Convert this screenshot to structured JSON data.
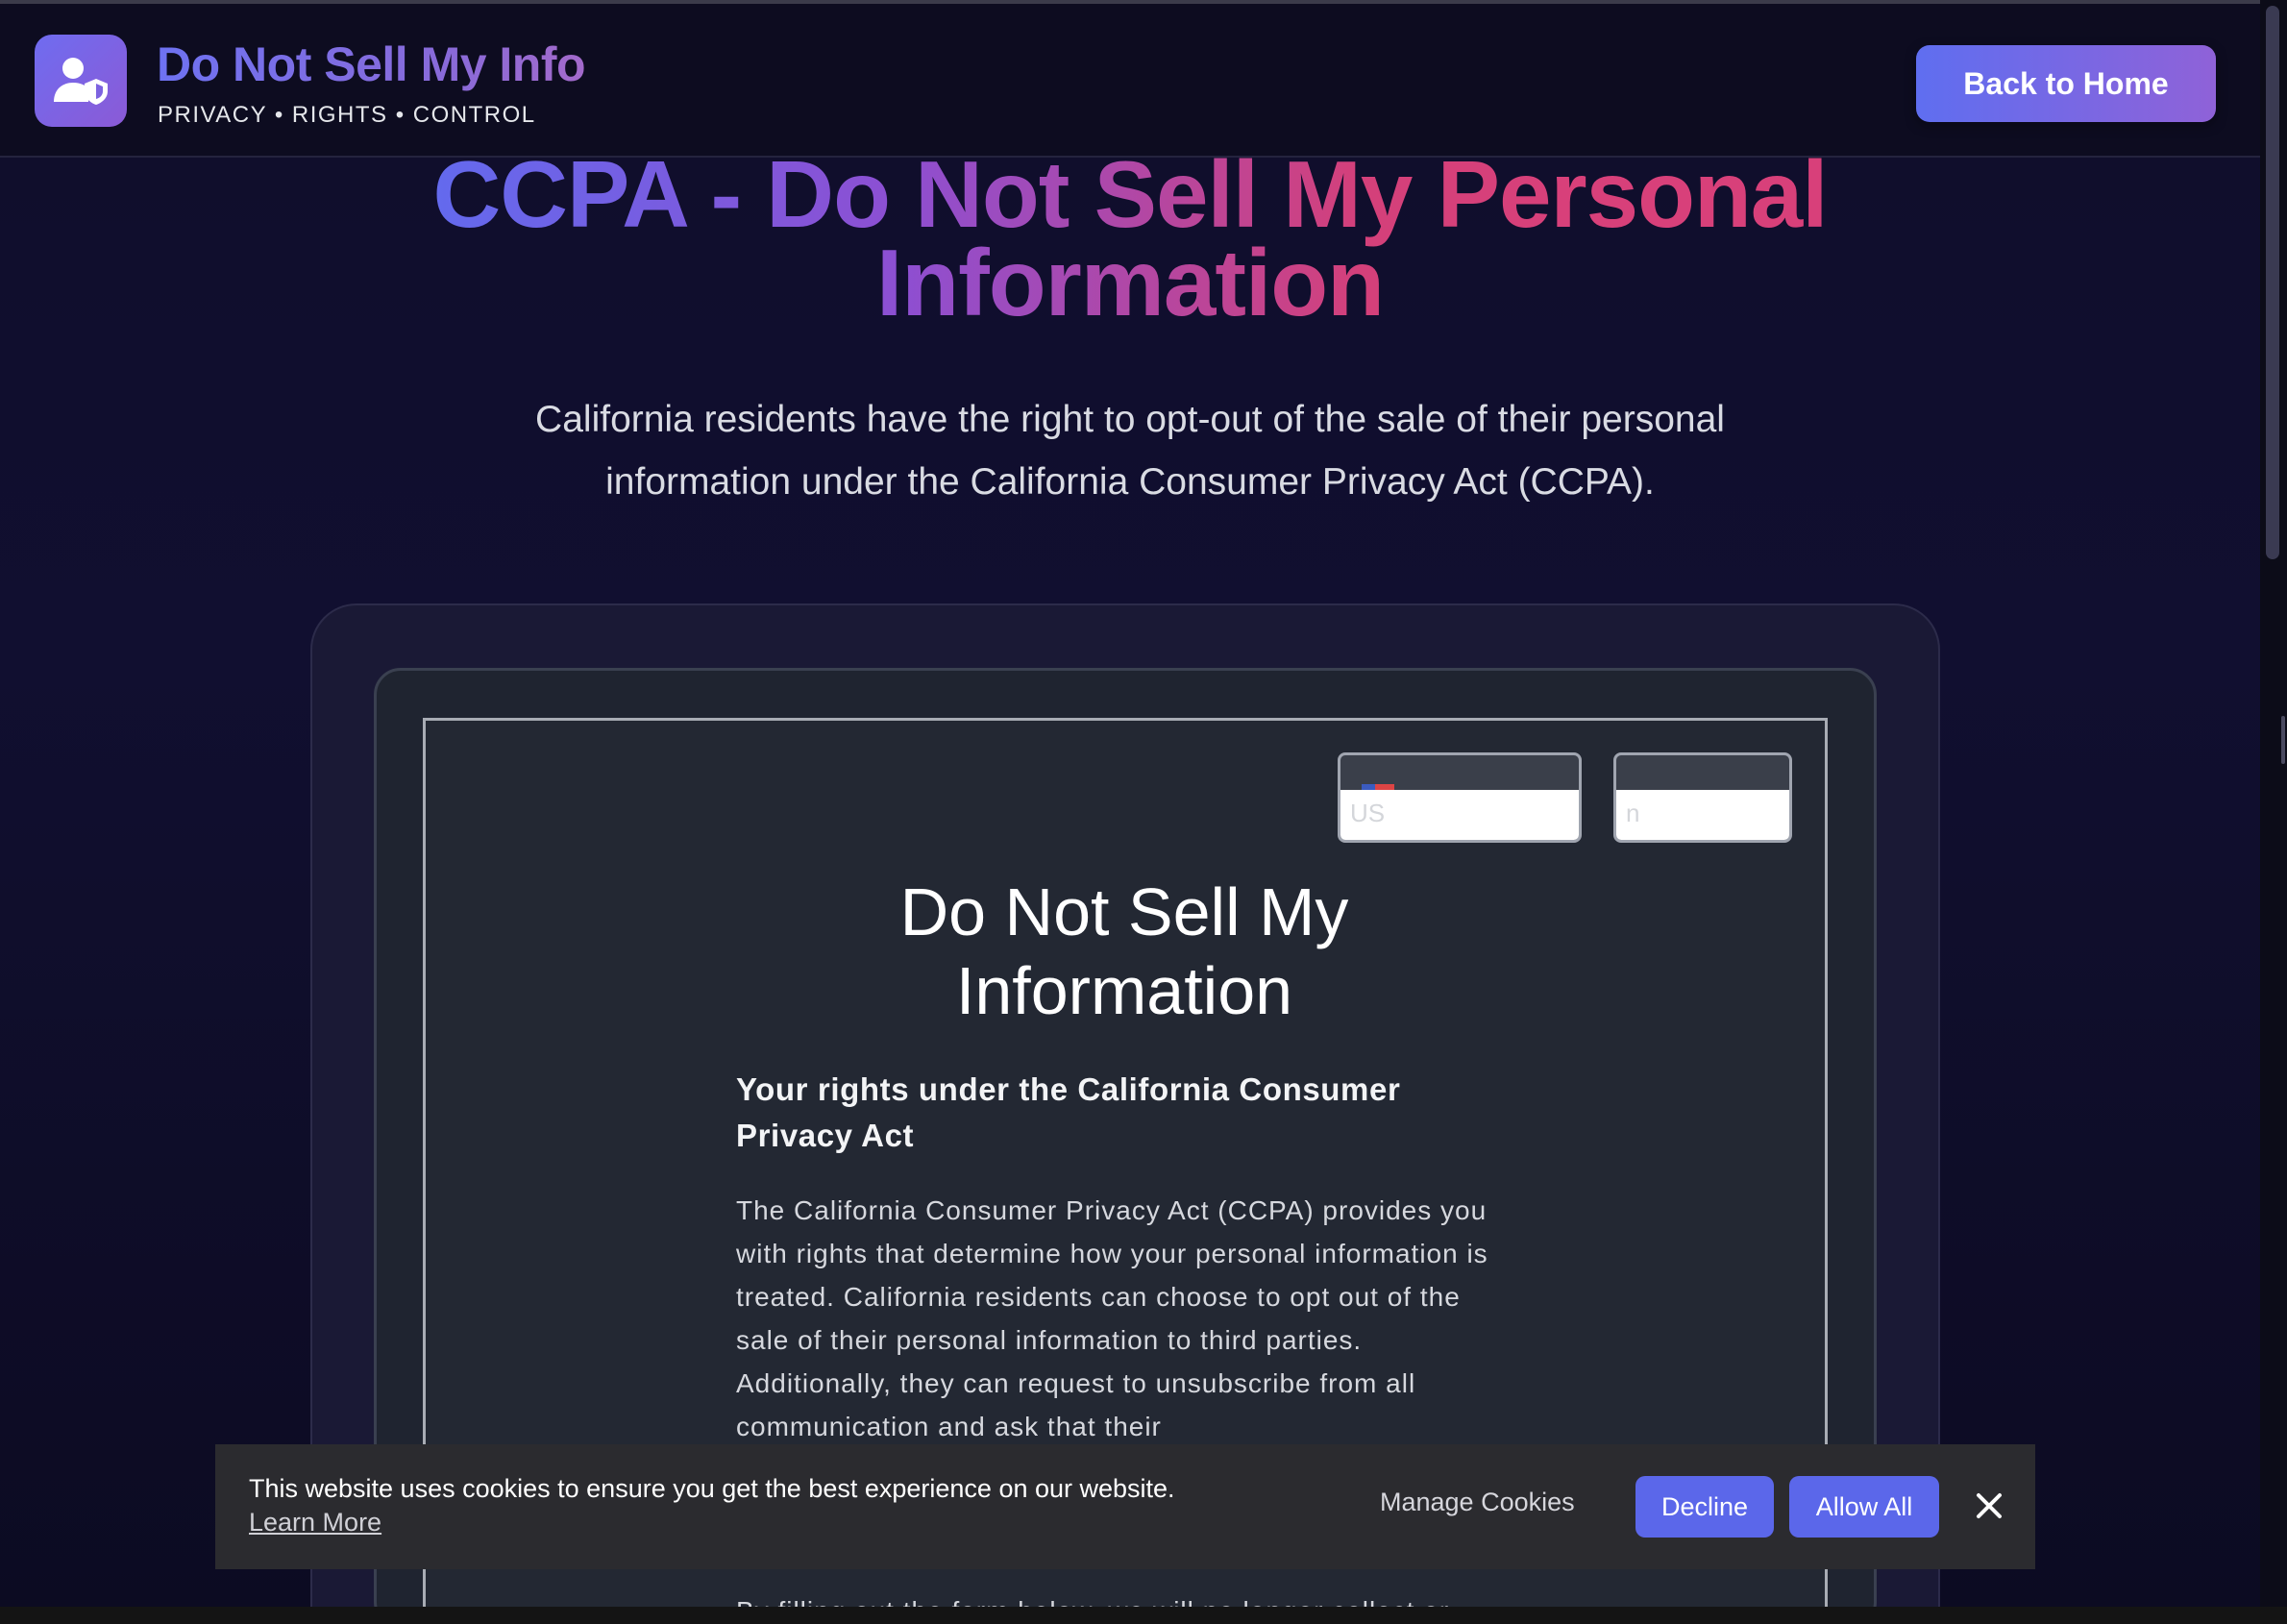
{
  "header": {
    "brand_title": "Do Not Sell My Info",
    "brand_tagline": "PRIVACY • RIGHTS • CONTROL",
    "back_button": "Back to Home",
    "logo_icon": "user-shield-icon"
  },
  "hero": {
    "title": "CCPA - Do Not Sell My Personal Information",
    "subtitle": "California residents have the right to opt-out of the sale of their personal information under the California Consumer Privacy Act (CCPA)."
  },
  "form": {
    "country_select_value": "US",
    "language_select_value": "n",
    "title": "Do Not Sell My Information",
    "rights_heading": "Your rights under the California Consumer Privacy Act",
    "rights_body": "The California Consumer Privacy Act (CCPA) provides you with rights that determine how your personal information is treated. California residents can choose to opt out of the sale of their personal information to third parties. Additionally, they can request to unsubscribe from all communication and ask that their",
    "rights_body_2": "By filling out the form below, we will no longer collect or"
  },
  "cookie_banner": {
    "message": "This website uses cookies to ensure you get the best experience on our website.",
    "learn_more": "Learn More",
    "manage": "Manage Cookies",
    "decline": "Decline",
    "allow_all": "Allow All",
    "close_icon": "close-icon"
  },
  "colors": {
    "accent": "#5b67ea",
    "background": "#0f0d2b",
    "gradient_pink": "#d4407a"
  }
}
